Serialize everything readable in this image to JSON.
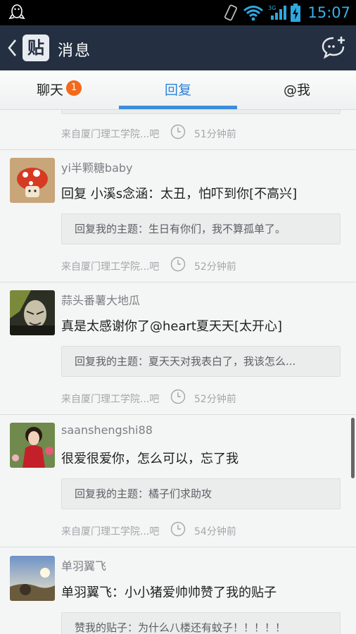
{
  "status_bar": {
    "time": "15:07",
    "network": "3G"
  },
  "title_bar": {
    "logo": "贴",
    "title": "消息",
    "back_icon": "back-chevron-icon",
    "new_chat_icon": "chat-bubble-plus-icon"
  },
  "tabs": [
    {
      "label": "聊天",
      "badge": "1",
      "active": false
    },
    {
      "label": "回复",
      "active": true
    },
    {
      "label": "@我",
      "active": false
    }
  ],
  "partial_item": {
    "source": "来自厦门理工学院...吧",
    "time": "51分钟前"
  },
  "replies": [
    {
      "username": "yi半颗糖baby",
      "content": "回复 小溪s念涵：太丑，怕吓到你[不高兴]",
      "quote": "回复我的主题：生日有你们，我不算孤单了。",
      "source": "来自厦门理工学院...吧",
      "time": "52分钟前"
    },
    {
      "username": "蒜头番薯大地瓜",
      "content": "真是太感谢你了@heart夏天天[太开心]",
      "quote": "回复我的主题：夏天天对我表白了，我该怎么...",
      "source": "来自厦门理工学院...吧",
      "time": "52分钟前"
    },
    {
      "username": "saanshengshi88",
      "content": "很爱很爱你，怎么可以，忘了我",
      "quote": "回复我的主题：橘子们求助攻",
      "source": "来自厦门理工学院...吧",
      "time": "54分钟前"
    },
    {
      "username": "单羽翼飞",
      "content": "单羽翼飞：小小猪爱帅帅赞了我的贴子",
      "quote": "赞我的贴子：为什么八楼还有蚊子！！！！！"
    }
  ],
  "colors": {
    "title_bar_bg": "#243042",
    "tab_active": "#2b82d9",
    "badge": "#f26a1b",
    "status_time": "#37b0e6"
  }
}
